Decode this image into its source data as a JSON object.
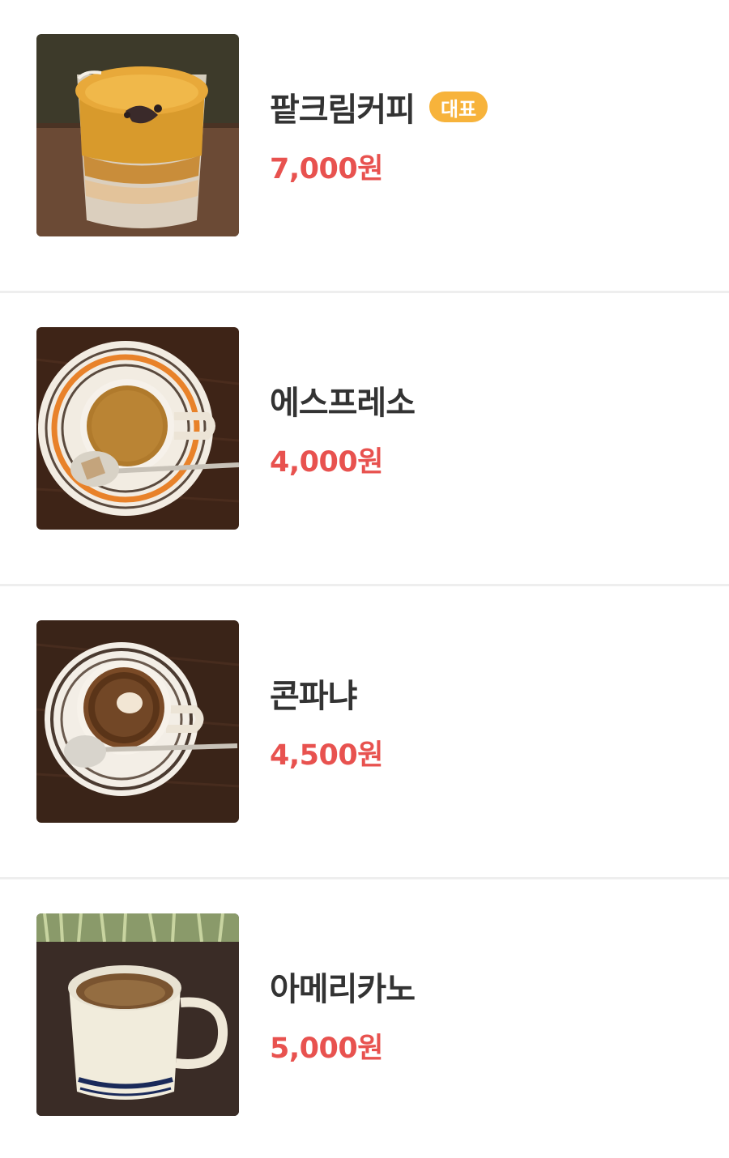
{
  "menu": {
    "items": [
      {
        "name": "팥크림커피",
        "badge": "대표",
        "price": "7,000원",
        "image_icon": "red-bean-cream-coffee-photo"
      },
      {
        "name": "에스프레소",
        "price": "4,000원",
        "image_icon": "espresso-photo"
      },
      {
        "name": "콘파냐",
        "price": "4,500원",
        "image_icon": "con-panna-photo"
      },
      {
        "name": "아메리카노",
        "price": "5,000원",
        "image_icon": "americano-photo"
      }
    ]
  },
  "colors": {
    "price": "#e8524f",
    "badge": "#f7b33b",
    "name": "#333333",
    "divider": "#eeeeee"
  }
}
